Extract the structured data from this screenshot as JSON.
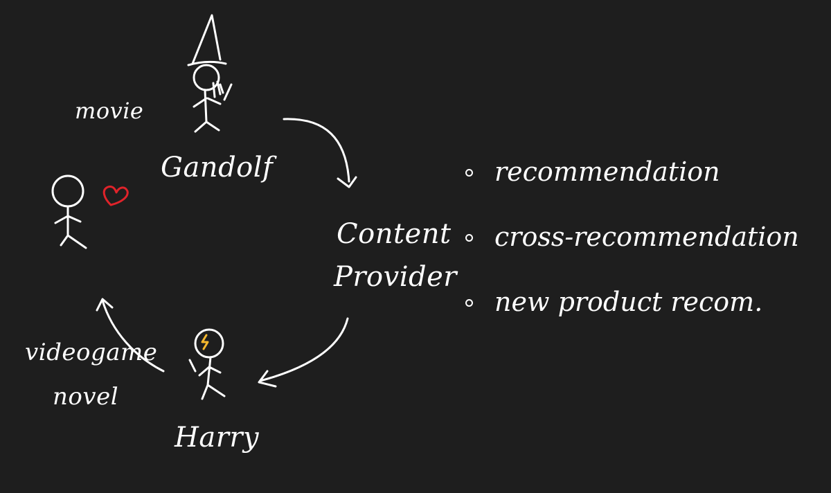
{
  "labels": {
    "movie": "movie",
    "gandolf": "Gandolf",
    "content": "Content",
    "provider": "Provider",
    "videogame": "videogame",
    "novel": "novel",
    "harry": "Harry"
  },
  "bullets": [
    "recommendation",
    "cross-recommendation",
    "new product recom."
  ],
  "colors": {
    "background": "#1e1e1e",
    "ink": "#ffffff",
    "heart": "#e0232a",
    "lightning": "#f5b82e"
  }
}
